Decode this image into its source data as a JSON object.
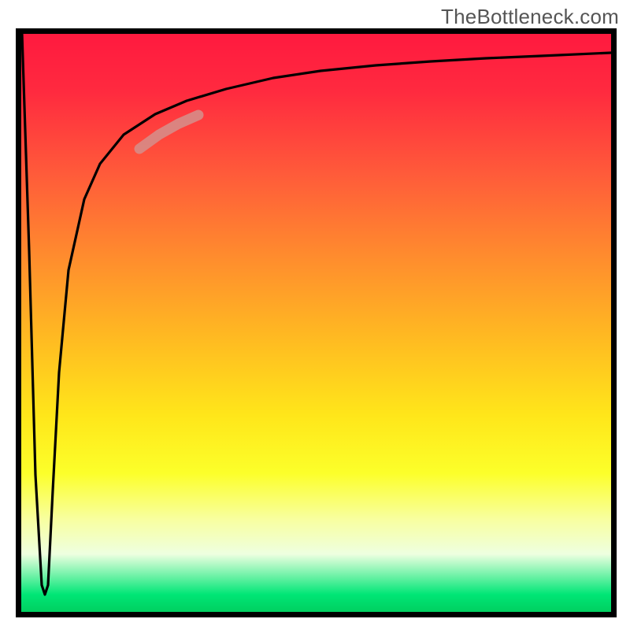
{
  "watermark": "TheBottleneck.com",
  "chart_data": {
    "type": "line",
    "title": "",
    "xlabel": "",
    "ylabel": "",
    "xlim": [
      0,
      100
    ],
    "ylim": [
      0,
      100
    ],
    "grid": false,
    "note": "Axes are implicit (unlabeled). y interpreted as bottleneck percentage, 0 at bottom (green) to 100 at top (red).",
    "series": [
      {
        "name": "bottleneck-curve",
        "x": [
          0,
          1,
          2,
          3,
          3.5,
          4,
          5,
          6,
          8,
          10,
          12,
          15,
          20,
          25,
          30,
          35,
          40,
          50,
          60,
          70,
          80,
          90,
          100
        ],
        "y": [
          100,
          60,
          20,
          3,
          2,
          8,
          30,
          50,
          65,
          73,
          78,
          82,
          86,
          88.5,
          90,
          91,
          92,
          93.5,
          94.5,
          95.2,
          95.8,
          96.3,
          96.7
        ]
      },
      {
        "name": "highlight-segment",
        "x": [
          20,
          24,
          28
        ],
        "y": [
          80,
          82.5,
          84.5
        ]
      }
    ],
    "gradient_stops": [
      {
        "pos": 0,
        "color": "#ff1a3f"
      },
      {
        "pos": 0.5,
        "color": "#ffd820"
      },
      {
        "pos": 0.85,
        "color": "#f8ffc0"
      },
      {
        "pos": 1.0,
        "color": "#00d060"
      }
    ]
  }
}
